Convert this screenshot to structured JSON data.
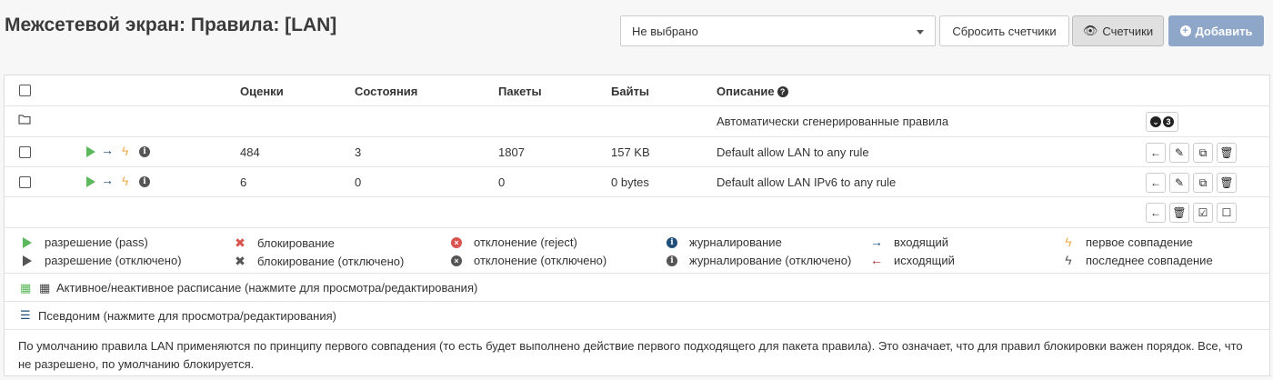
{
  "header": {
    "title": "Межсетевой экран: Правила: [LAN]",
    "select_value": "Не выбрано",
    "reset_counters_label": "Сбросить счетчики",
    "counters_label": "Счетчики",
    "add_label": "Добавить"
  },
  "table": {
    "columns": [
      "Оценки",
      "Состояния",
      "Пакеты",
      "Байты",
      "Описание"
    ],
    "group_row": {
      "description": "Автоматически сгенерированные правила",
      "count": "3"
    },
    "rows": [
      {
        "evaluations": "484",
        "states": "3",
        "packets": "1807",
        "bytes": "157 KB",
        "description": "Default allow LAN to any rule"
      },
      {
        "evaluations": "6",
        "states": "0",
        "packets": "0",
        "bytes": "0 bytes",
        "description": "Default allow LAN IPv6 to any rule"
      }
    ]
  },
  "legend": {
    "pass": "разрешение (pass)",
    "pass_disabled": "разрешение (отключено)",
    "block": "блокирование",
    "block_disabled": "блокирование (отключено)",
    "reject": "отклонение (reject)",
    "reject_disabled": "отклонение (отключено)",
    "log": "журналирование",
    "log_disabled": "журналирование (отключено)",
    "in": "входящий",
    "out": "исходящий",
    "first_match": "первое совпадение",
    "last_match": "последнее совпадение"
  },
  "notes": {
    "schedule": "Активное/неактивное расписание (нажмите для просмотра/редактирования)",
    "alias": "Псевдоним (нажмите для просмотра/редактирования)",
    "default_policy": "По умолчанию правила LAN применяются по принципу первого совпадения (то есть будет выполнено действие первого подходящего для пакета правила). Это означает, что для правил блокировки важен порядок. Все, что не разрешено, по умолчанию блокируется."
  },
  "colors": {
    "pass": "#5cb85c",
    "block": "#d9534f",
    "add_button": "#8ea6c7",
    "direction_in": "#1f4e79",
    "first_match": "#f0ad4e"
  }
}
